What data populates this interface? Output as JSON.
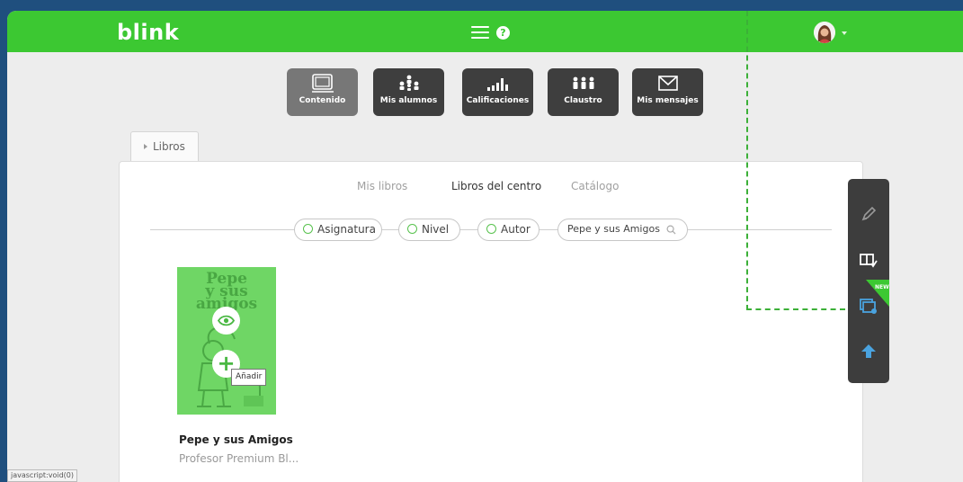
{
  "header": {
    "logo": "blink",
    "help": "?"
  },
  "nav": {
    "items": [
      {
        "label": "Contenido"
      },
      {
        "label": "Mis alumnos"
      },
      {
        "label": "Calificaciones"
      },
      {
        "label": "Claustro"
      },
      {
        "label": "Mis mensajes"
      }
    ]
  },
  "breadcrumb": {
    "tab": "Libros"
  },
  "subtabs": {
    "mis_libros": "Mis libros",
    "libros_centro": "Libros del centro",
    "catalogo": "Catálogo"
  },
  "filters": {
    "asignatura": "Asignatura",
    "nivel": "Nivel",
    "autor": "Autor",
    "search_value": "Pepe y sus Amigos"
  },
  "book": {
    "cover_line1": "Pepe",
    "cover_line2": "y sus",
    "cover_line3": "amigos",
    "title": "Pepe y sus Amigos",
    "author": "Profesor Premium Bl...",
    "tooltip": "Añadir"
  },
  "sidetools": {
    "new_badge": "NEW",
    "icons": [
      "pencil-icon",
      "book-check-icon",
      "new-window-icon",
      "upload-arrow-icon"
    ]
  },
  "statusbar": {
    "text": "javascript:void(0)"
  },
  "colors": {
    "brand_green": "#3cc832",
    "nav_dark": "#3e3e3e",
    "nav_active": "#777777",
    "tool_dark": "#3d3d3d",
    "accent_blue": "#4aa3df"
  }
}
